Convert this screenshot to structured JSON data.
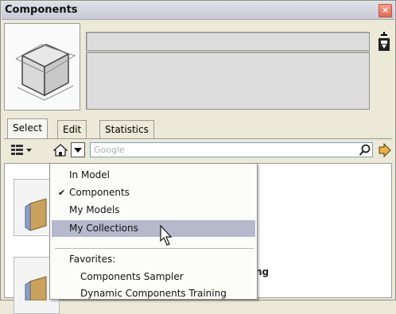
{
  "window": {
    "title": "Components",
    "close_glyph": "×"
  },
  "tabs": [
    {
      "label": "Select",
      "active": true
    },
    {
      "label": "Edit",
      "active": false
    },
    {
      "label": "Statistics",
      "active": false
    }
  ],
  "toolbar": {
    "view_options_icon": "view-options-icon",
    "home_icon": "home-icon",
    "nav_dropdown_icon": "chevron-down-icon",
    "search_placeholder": "Google",
    "search_icon": "search-icon",
    "details_icon": "arrow-right-icon"
  },
  "menu": {
    "items": [
      {
        "label": "In Model",
        "checked": false
      },
      {
        "label": "Components",
        "checked": true
      },
      {
        "label": "My Models",
        "checked": false
      },
      {
        "label": "My Collections",
        "checked": false,
        "highlighted": true
      }
    ],
    "favorites_heading": "Favorites:",
    "favorites": [
      {
        "label": "Components Sampler"
      },
      {
        "label": "Dynamic Components Training"
      }
    ],
    "check_glyph": "✔"
  },
  "list": {
    "partial_label": "ng"
  },
  "colors": {
    "accent_highlight": "#b6b8cc",
    "close_button": "#e06a52",
    "titlebar": "#d4d5df"
  }
}
